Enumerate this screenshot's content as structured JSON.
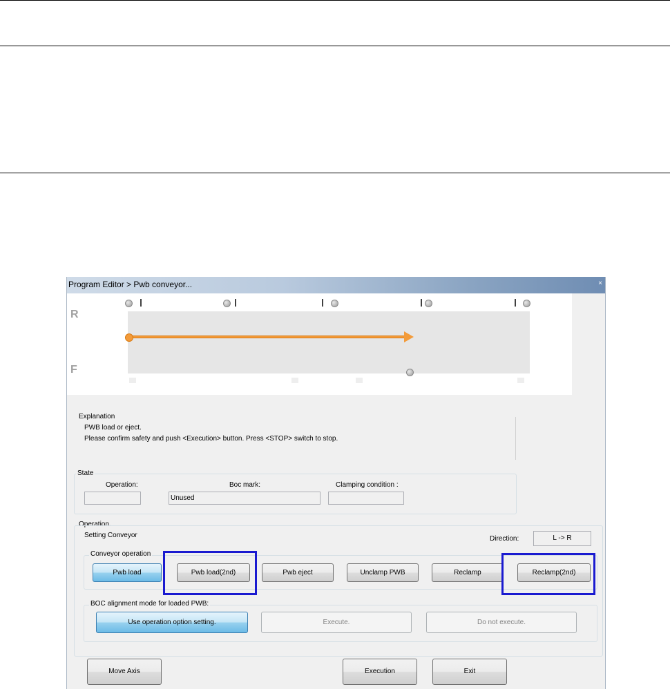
{
  "window": {
    "title": "Program Editor > Pwb conveyor...",
    "close_glyph": "×"
  },
  "diagram": {
    "rear_label": "R",
    "front_label": "F",
    "direction_arrow": "left-to-right",
    "accent_color": "#f39b3a"
  },
  "explanation": {
    "heading": "Explanation",
    "line1": "PWB load or eject.",
    "line2": "Please confirm safety and push <Execution> button. Press <STOP> switch to stop."
  },
  "state": {
    "heading": "State",
    "operation_label": "Operation:",
    "operation_value": "",
    "boc_label": "Boc mark:",
    "boc_value": "Unused",
    "clamp_label": "Clamping condition :",
    "clamp_value": ""
  },
  "operation": {
    "heading": "Operation.",
    "setting_label": "Setting Conveyor",
    "direction_label": "Direction:",
    "direction_value": "L -> R",
    "conveyor_heading": "Conveyor operation",
    "buttons": {
      "pwb_load": "Pwb load",
      "pwb_load_2nd": "Pwb load(2nd)",
      "pwb_eject": "Pwb eject",
      "unclamp": "Unclamp PWB",
      "reclamp": "Reclamp",
      "reclamp_2nd": "Reclamp(2nd)"
    },
    "boc_heading": "BOC alignment mode for loaded PWB:",
    "boc_buttons": {
      "use_option": "Use operation option setting.",
      "execute": "Execute.",
      "do_not": "Do not execute."
    }
  },
  "footer": {
    "move_axis": "Move Axis",
    "execution": "Execution",
    "exit": "Exit"
  },
  "highlight_color": "#1a1ad0"
}
